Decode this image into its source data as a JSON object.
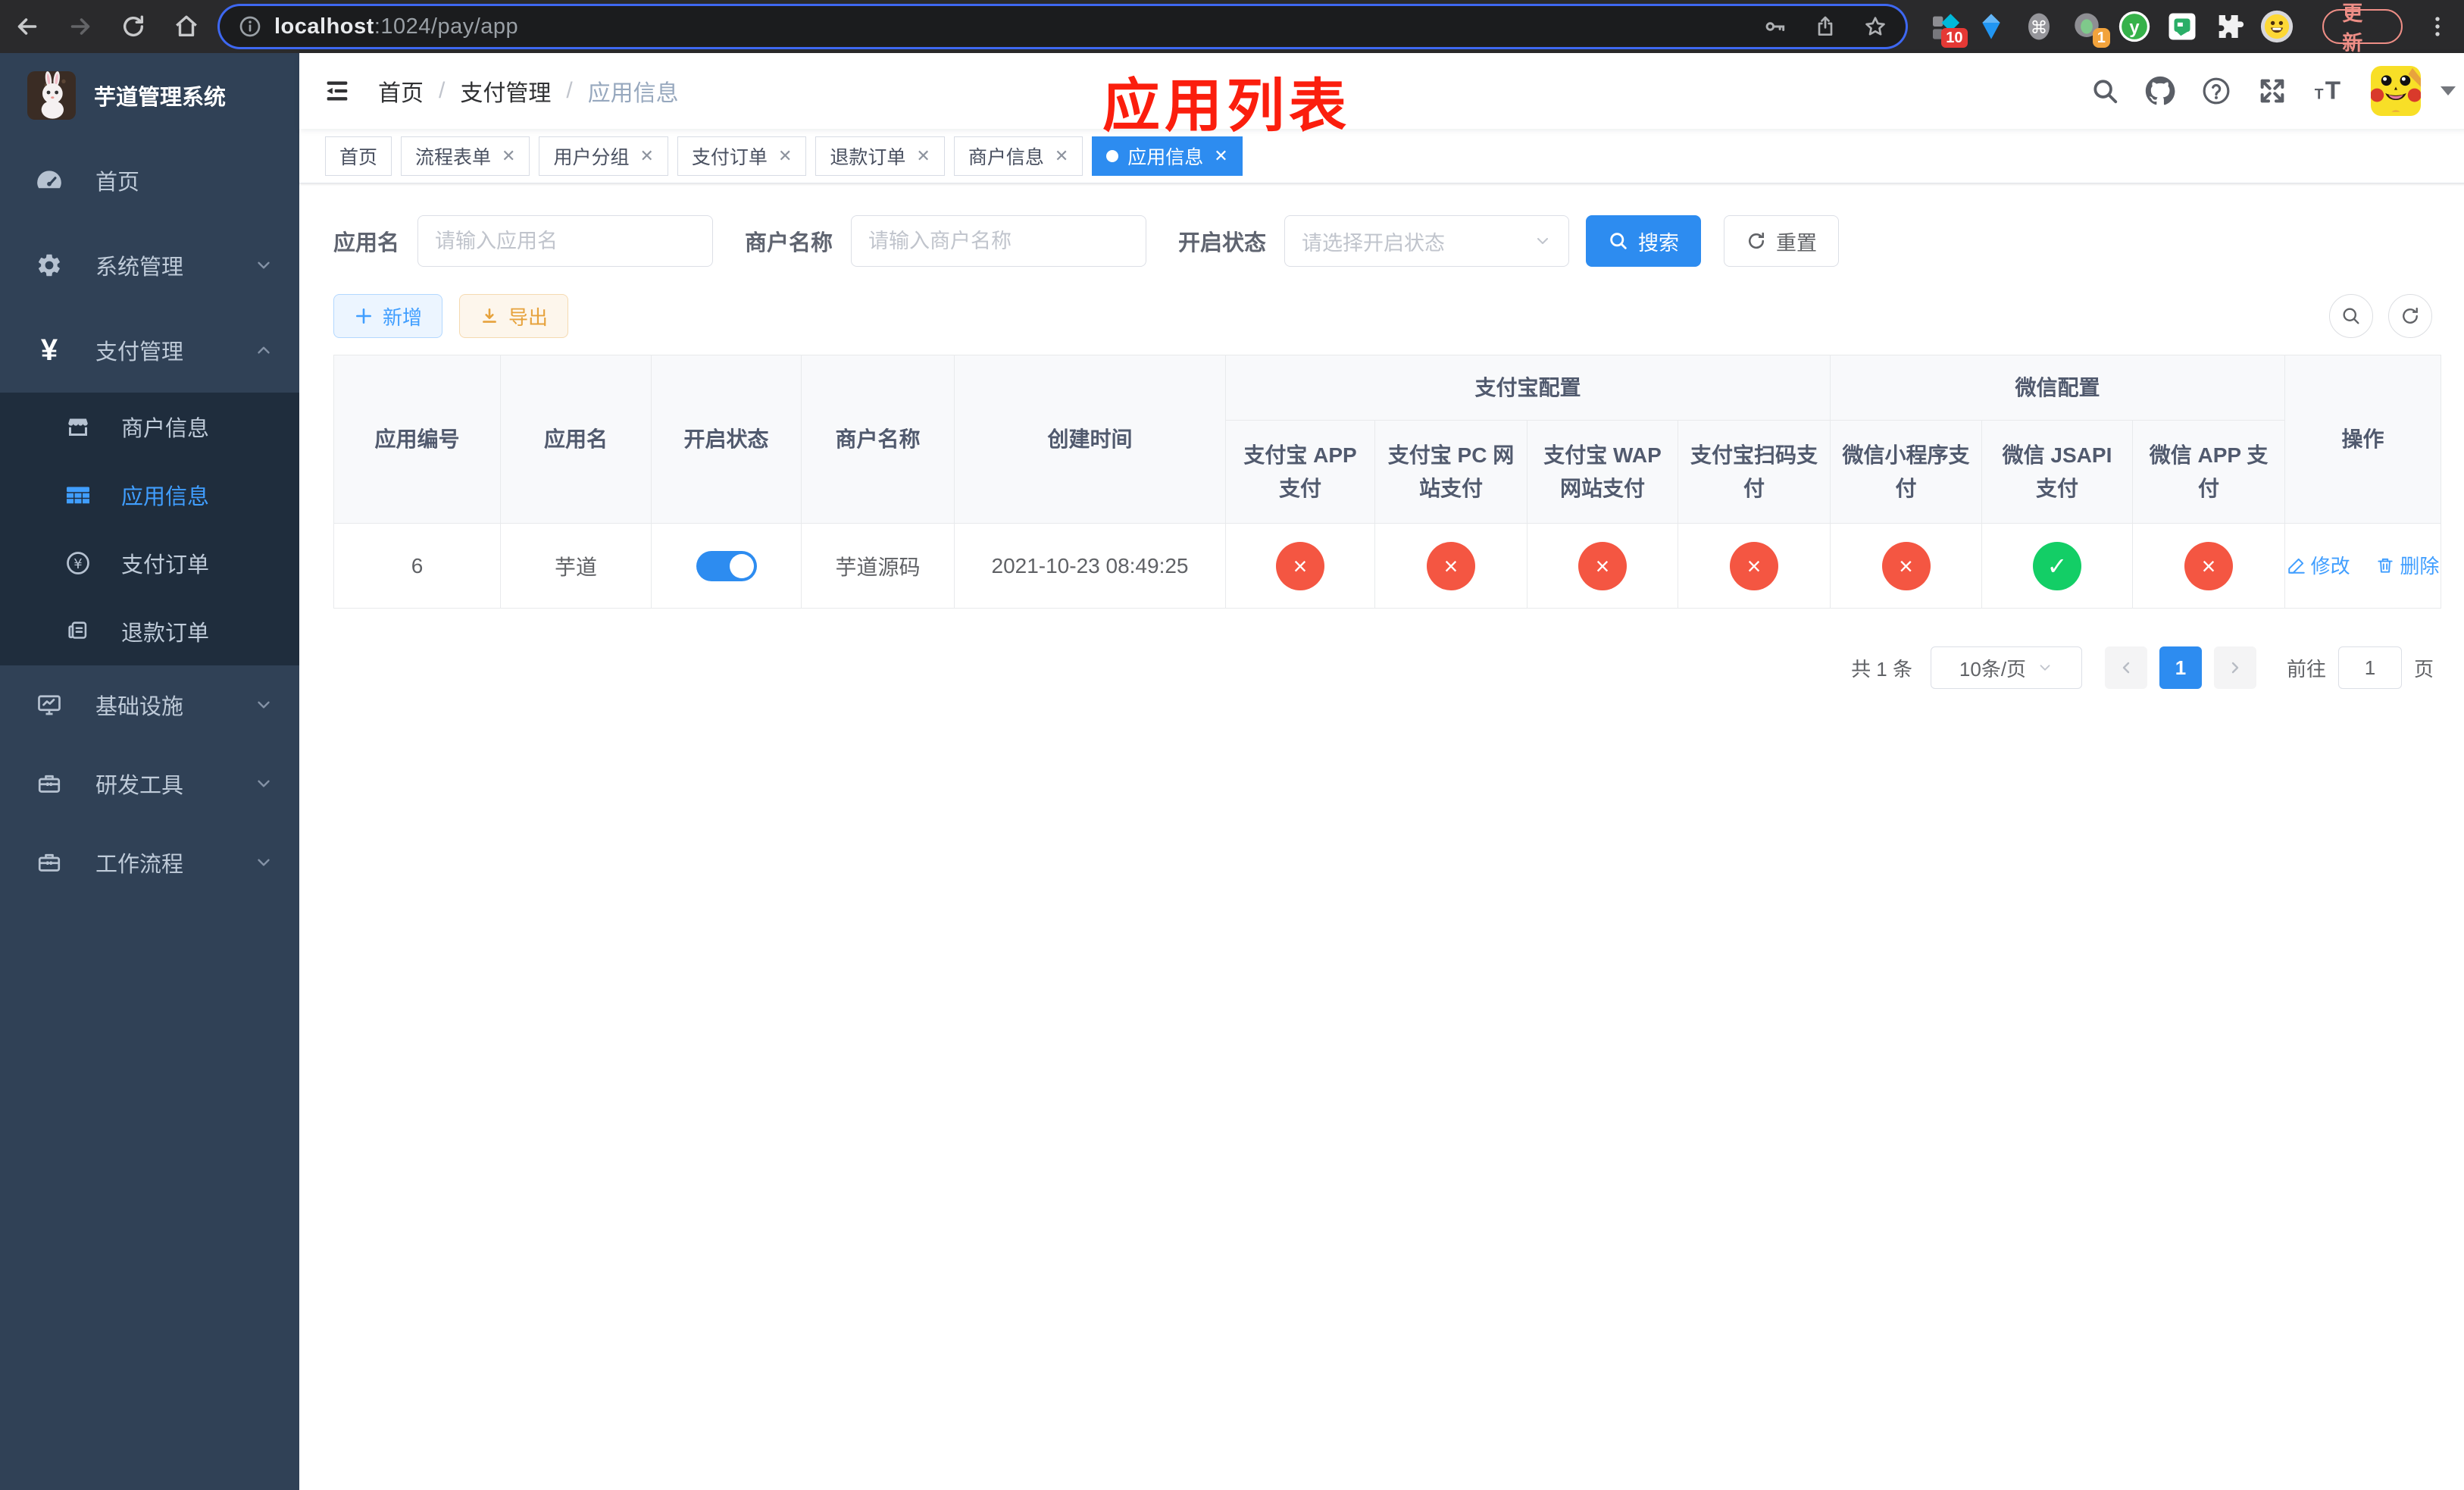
{
  "browser": {
    "url_host": "localhost",
    "url_path": ":1024/pay/app",
    "update_label": "更新",
    "badges": {
      "grid_ext": "10",
      "loom_ext": "1"
    }
  },
  "sidebar": {
    "title": "芋道管理系统",
    "items": [
      {
        "label": "首页",
        "icon": "dashboard-icon"
      },
      {
        "label": "系统管理",
        "icon": "gear-icon",
        "expanded": false
      },
      {
        "label": "支付管理",
        "icon": "yen-icon",
        "expanded": true
      },
      {
        "label": "基础设施",
        "icon": "monitor-icon",
        "expanded": false
      },
      {
        "label": "研发工具",
        "icon": "toolbox-icon",
        "expanded": false
      },
      {
        "label": "工作流程",
        "icon": "workflow-icon",
        "expanded": false
      }
    ],
    "sub_items": [
      {
        "label": "商户信息",
        "icon": "shop-icon",
        "active": false
      },
      {
        "label": "应用信息",
        "icon": "grid-icon",
        "active": true
      },
      {
        "label": "支付订单",
        "icon": "coin-icon",
        "active": false
      },
      {
        "label": "退款订单",
        "icon": "document-icon",
        "active": false
      }
    ]
  },
  "header": {
    "breadcrumb": [
      "首页",
      "支付管理",
      "应用信息"
    ],
    "annotation": "应用列表"
  },
  "tags": [
    {
      "label": "首页",
      "closable": false,
      "active": false
    },
    {
      "label": "流程表单",
      "closable": true,
      "active": false
    },
    {
      "label": "用户分组",
      "closable": true,
      "active": false
    },
    {
      "label": "支付订单",
      "closable": true,
      "active": false
    },
    {
      "label": "退款订单",
      "closable": true,
      "active": false
    },
    {
      "label": "商户信息",
      "closable": true,
      "active": false
    },
    {
      "label": "应用信息",
      "closable": true,
      "active": true
    }
  ],
  "filters": {
    "app_name": {
      "label": "应用名",
      "placeholder": "请输入应用名",
      "value": ""
    },
    "merchant_name": {
      "label": "商户名称",
      "placeholder": "请输入商户名称",
      "value": ""
    },
    "status": {
      "label": "开启状态",
      "placeholder": "请选择开启状态",
      "value": ""
    },
    "search_label": "搜索",
    "reset_label": "重置"
  },
  "toolbar": {
    "add_label": "新增",
    "export_label": "导出"
  },
  "table": {
    "columns": [
      "应用编号",
      "应用名",
      "开启状态",
      "商户名称",
      "创建时间"
    ],
    "groups": [
      "支付宝配置",
      "微信配置"
    ],
    "sub_columns": [
      "支付宝 APP 支付",
      "支付宝 PC 网站支付",
      "支付宝 WAP 网站支付",
      "支付宝扫码支付",
      "微信小程序支付",
      "微信 JSAPI 支付",
      "微信 APP 支付"
    ],
    "action_column": "操作",
    "row": {
      "id": "6",
      "name": "芋道",
      "enabled": true,
      "merchant": "芋道源码",
      "created_at": "2021-10-23 08:49:25",
      "pay_status": [
        "fail",
        "fail",
        "fail",
        "fail",
        "fail",
        "success",
        "fail"
      ],
      "edit_label": "修改",
      "delete_label": "删除"
    }
  },
  "pagination": {
    "total": "共 1 条",
    "page_size": "10条/页",
    "page": "1",
    "goto_label": "前往",
    "goto_value": "1",
    "unit_label": "页"
  },
  "colors": {
    "primary": "#2d8cf0",
    "link": "#409eff",
    "success": "#13ce66",
    "danger": "#f45642",
    "warning": "#e6a23c",
    "sidebar": "#304156",
    "submenu": "#1f2d3d",
    "annotation": "#fb1e0d"
  }
}
